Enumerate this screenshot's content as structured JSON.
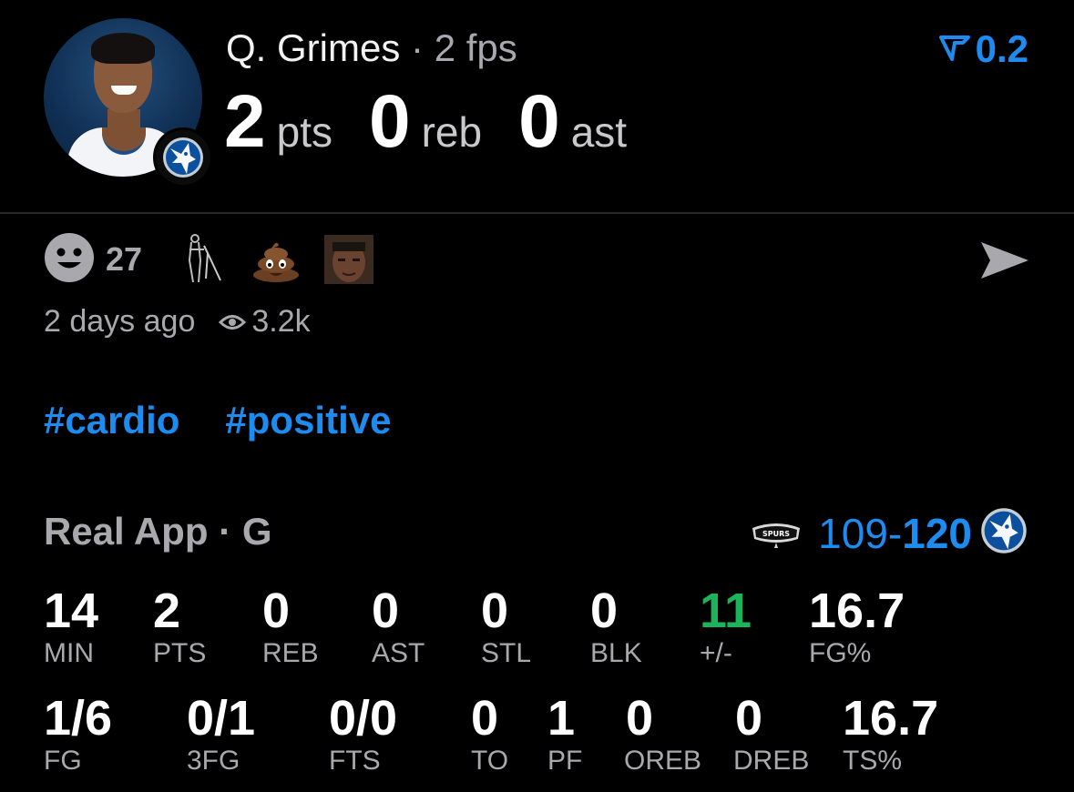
{
  "player": {
    "name": "Q. Grimes",
    "separator": "·",
    "fps": "2 fps",
    "pts": "2",
    "pts_unit": "pts",
    "reb": "0",
    "reb_unit": "reb",
    "ast": "0",
    "ast_unit": "ast",
    "rating": "0.2",
    "rating_icon": "tick-icon"
  },
  "reactions": {
    "count": "27",
    "icons": [
      "smiley-icon",
      "walker-emoji",
      "poop-emoji",
      "player-face-emoji"
    ]
  },
  "meta": {
    "time_ago": "2 days ago",
    "views": "3.2k"
  },
  "tags": [
    "#cardio",
    "#positive"
  ],
  "game": {
    "source": "Real App",
    "separator": "·",
    "position": "G",
    "away_score": "109",
    "dash": "-",
    "home_score": "120",
    "spurs_text": "SPURS"
  },
  "stats_row1": [
    {
      "value": "14",
      "label": "MIN"
    },
    {
      "value": "2",
      "label": "PTS"
    },
    {
      "value": "0",
      "label": "REB"
    },
    {
      "value": "0",
      "label": "AST"
    },
    {
      "value": "0",
      "label": "STL"
    },
    {
      "value": "0",
      "label": "BLK"
    },
    {
      "value": "11",
      "label": "+/-"
    },
    {
      "value": "16.7",
      "label": "FG%"
    }
  ],
  "stats_row2": [
    {
      "value": "1/6",
      "label": "FG"
    },
    {
      "value": "0/1",
      "label": "3FG"
    },
    {
      "value": "0/0",
      "label": "FTS"
    },
    {
      "value": "0",
      "label": "TO"
    },
    {
      "value": "1",
      "label": "PF"
    },
    {
      "value": "0",
      "label": "OREB"
    },
    {
      "value": "0",
      "label": "DREB"
    },
    {
      "value": "16.7",
      "label": "TS%"
    }
  ],
  "colors": {
    "accent": "#1d8cf0",
    "positive": "#1bb45b",
    "muted": "#a9a9ad",
    "background": "#000000"
  }
}
